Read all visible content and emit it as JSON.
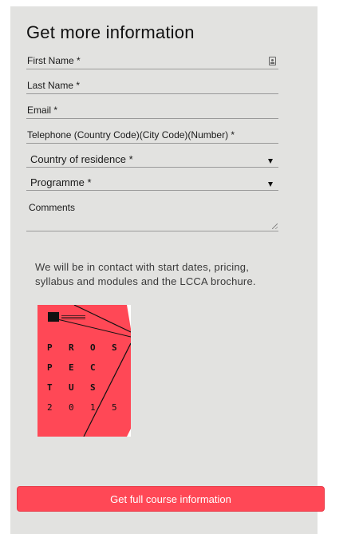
{
  "form": {
    "title": "Get more information",
    "fields": {
      "first_name": "First Name *",
      "last_name": "Last Name *",
      "email": "Email *",
      "telephone": "Telephone (Country Code)(City Code)(Number)  *"
    },
    "selects": {
      "country": "Country of residence *",
      "programme": "Programme *"
    },
    "comments": "Comments",
    "info_text": "We will be in contact with start dates, pricing, syllabus and modules and the LCCA brochure.",
    "brochure": {
      "rows": [
        [
          "P",
          "R",
          "O",
          "S"
        ],
        [
          "P",
          "E",
          "C",
          ""
        ],
        [
          "T",
          "U",
          "S",
          ""
        ],
        [
          "2",
          "0",
          "1",
          "5"
        ]
      ]
    },
    "submit_label": "Get full course information"
  },
  "colors": {
    "accent": "#ff4856",
    "panel": "#e2e2e0"
  }
}
